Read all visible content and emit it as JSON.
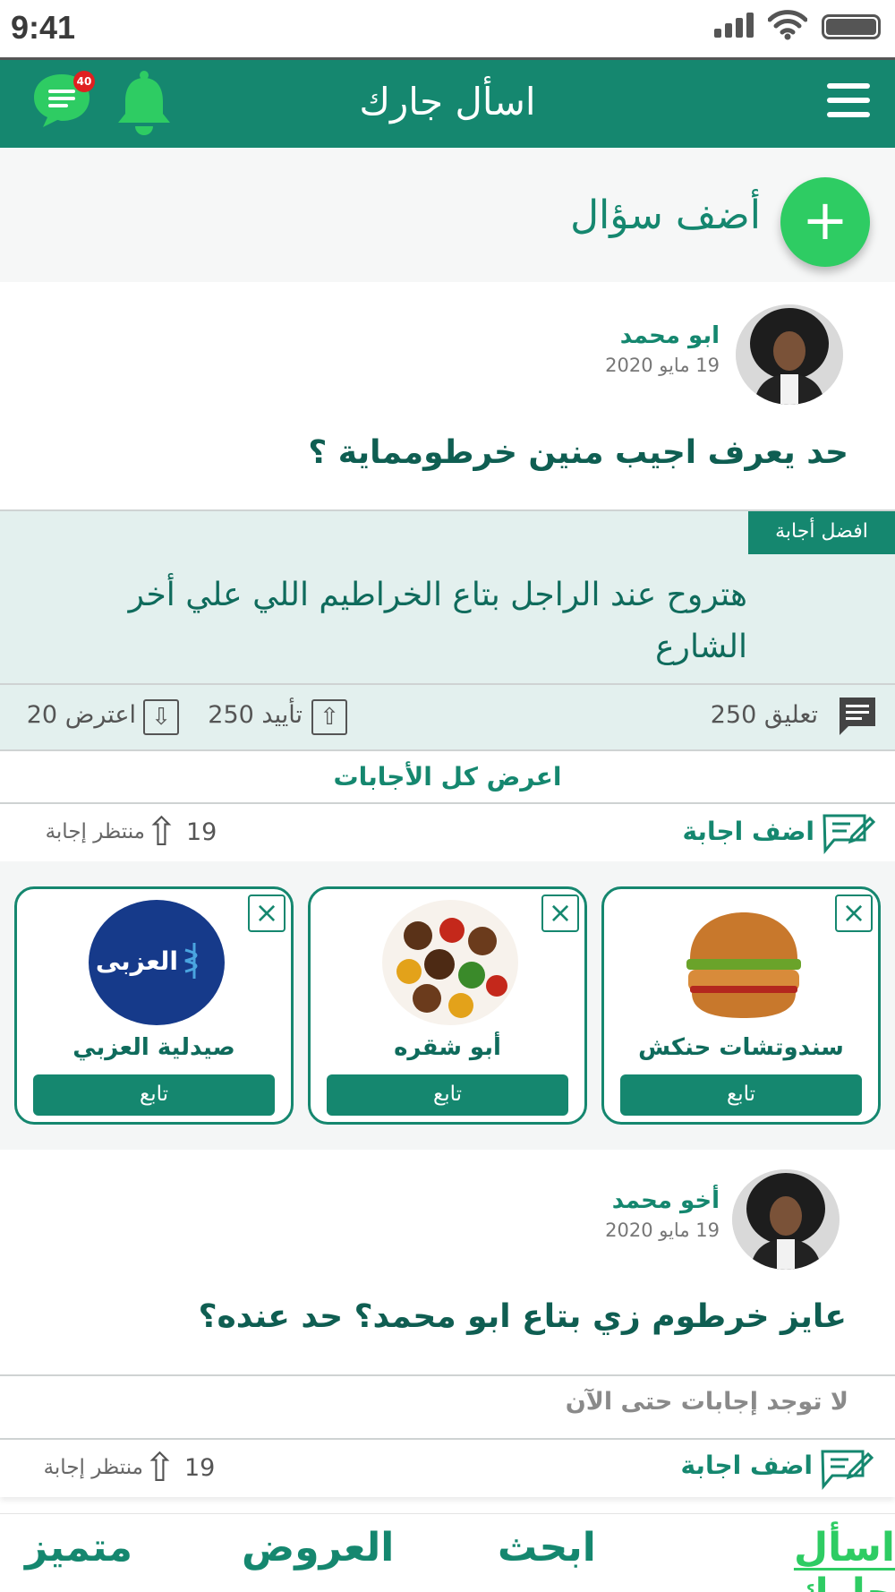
{
  "status": {
    "time": "9:41"
  },
  "header": {
    "title": "اسأل جارك",
    "chat_badge": "40"
  },
  "add_question": {
    "label": "أضف سؤال",
    "icon": "+"
  },
  "posts": [
    {
      "user": "ابو محمد",
      "date": "19 مايو 2020",
      "question": "حد يعرف اجيب منين خرطومماية ؟",
      "best_answer_badge": "افضل أجابة",
      "best_answer": "هتروح عند الراجل بتاع الخراطيم اللي علي أخر الشارع",
      "comments": "تعليق 250",
      "upvotes": "تأييد 250",
      "downvotes": "اعترض 20",
      "view_all": "اعرض كل الأجابات",
      "add_answer": "اضف اجابة",
      "waiting_count": "19",
      "waiting_label": "منتظر إجابة"
    },
    {
      "user": "أخو محمد",
      "date": "19 مايو 2020",
      "question": "عايز خرطوم زي بتاع ابو محمد؟ حد عنده؟",
      "no_answers": "لا توجد إجابات حتى الآن",
      "add_answer": "اضف اجابة",
      "waiting_count": "19",
      "waiting_label": "منتظر إجابة"
    }
  ],
  "ads": [
    {
      "name": "سندوتشات حنكش",
      "follow": "تابع",
      "image": "burger"
    },
    {
      "name": "أبو شقره",
      "follow": "تابع",
      "image": "kebab"
    },
    {
      "name": "صيدلية العزبي",
      "follow": "تابع",
      "image": "pharmacy-logo",
      "logo_text": "العزبى"
    }
  ],
  "nav": {
    "ask": "اسأل جارك",
    "search": "ابحث",
    "offers": "العروض",
    "featured": "متميز"
  },
  "colors": {
    "primary": "#15876f",
    "accent": "#2ecc63",
    "badge": "#e02020"
  }
}
